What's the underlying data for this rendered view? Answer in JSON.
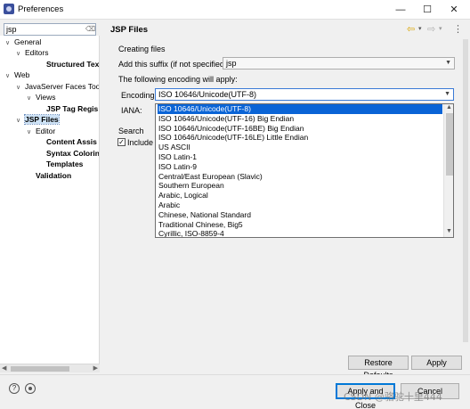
{
  "window": {
    "title": "Preferences",
    "controls": {
      "minimize": "—",
      "maximize": "☐",
      "close": "✕"
    }
  },
  "sidebar": {
    "filter_value": "jsp",
    "filter_clear_icon": "clear-filter-icon",
    "tree": [
      {
        "label": "General",
        "twisty": "∨",
        "bold": false,
        "selected": false
      },
      {
        "label": "Editors",
        "twisty": "∨",
        "bold": false,
        "selected": false
      },
      {
        "label": "Structured Text E",
        "twisty": "",
        "bold": true,
        "selected": false
      },
      {
        "label": "Web",
        "twisty": "∨",
        "bold": false,
        "selected": false
      },
      {
        "label": "JavaServer Faces Too",
        "twisty": "∨",
        "bold": false,
        "selected": false
      },
      {
        "label": "Views",
        "twisty": "∨",
        "bold": false,
        "selected": false
      },
      {
        "label": "JSP Tag Regis",
        "twisty": "",
        "bold": true,
        "selected": false
      },
      {
        "label": "JSP Files",
        "twisty": "∨",
        "bold": true,
        "selected": true
      },
      {
        "label": "Editor",
        "twisty": "∨",
        "bold": false,
        "selected": false
      },
      {
        "label": "Content Assis",
        "twisty": "",
        "bold": true,
        "selected": false
      },
      {
        "label": "Syntax Colorin",
        "twisty": "",
        "bold": true,
        "selected": false
      },
      {
        "label": "Templates",
        "twisty": "",
        "bold": true,
        "selected": false
      },
      {
        "label": "Validation",
        "twisty": "",
        "bold": true,
        "selected": false
      }
    ]
  },
  "page": {
    "title": "JSP Files",
    "nav": {
      "back_icon": "⇦",
      "menu_icon": "▾",
      "forward_icon": "⇨",
      "more_icon": "⋮"
    },
    "creating_files": {
      "group_label": "Creating files",
      "suffix_label": "Add this suffix (if not specified):",
      "suffix_value": "jsp",
      "encoding_intro": "The following encoding will apply:",
      "encoding_label": "Encoding:",
      "encoding_value": "ISO 10646/Unicode(UTF-8)",
      "iana_label": "IANA:"
    },
    "search": {
      "group_label": "Search",
      "include_label": "Include J",
      "include_checked": true
    }
  },
  "encoding_dropdown": {
    "options": [
      "ISO 10646/Unicode(UTF-8)",
      "ISO 10646/Unicode(UTF-16) Big Endian",
      "ISO 10646/Unicode(UTF-16BE) Big Endian",
      "ISO 10646/Unicode(UTF-16LE) Little Endian",
      "US ASCII",
      "ISO Latin-1",
      "ISO Latin-9",
      "Central/East European (Slavic)",
      "Southern European",
      "Arabic, Logical",
      "Arabic",
      "Chinese, National Standard",
      "Traditional Chinese, Big5",
      "Cyrillic, ISO-8859-4"
    ],
    "selected_index": 0
  },
  "buttons": {
    "restore_defaults": "Restore Defaults",
    "apply": "Apply",
    "apply_and_close": "Apply and Close",
    "cancel": "Cancel"
  },
  "footer": {
    "help_icon": "?",
    "watermark": "CSDN @骆驼十里444"
  },
  "colors": {
    "selection_blue": "#0a64d6",
    "focus_border": "#3b7ad6",
    "tree_selection": "#cde2f6"
  }
}
